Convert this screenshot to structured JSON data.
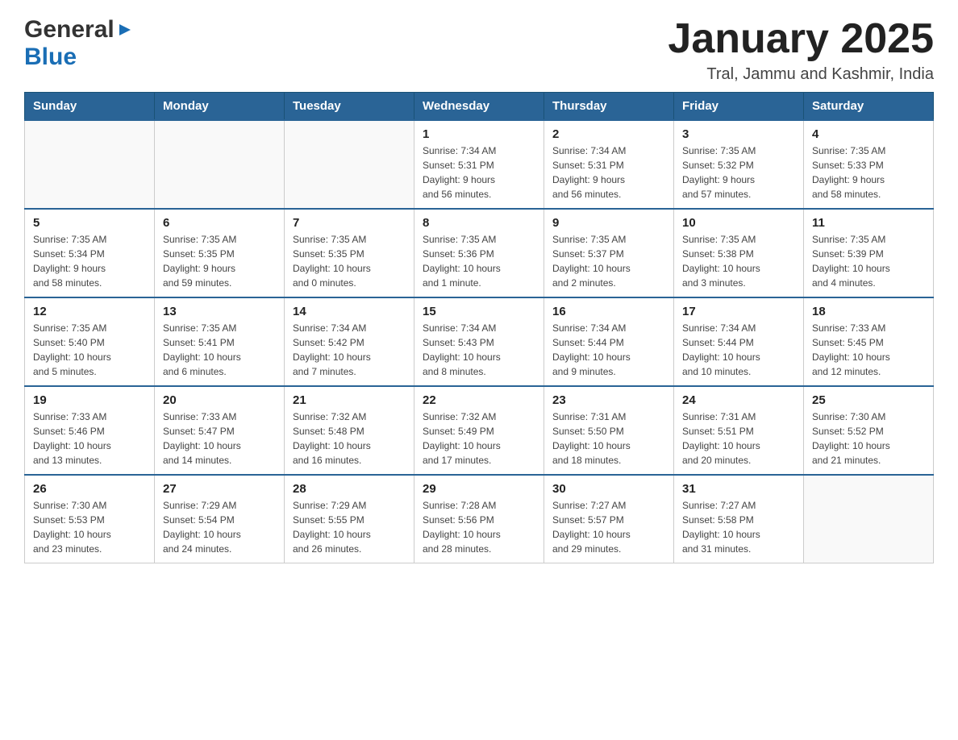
{
  "header": {
    "logo_general": "General",
    "logo_blue": "Blue",
    "month_year": "January 2025",
    "location": "Tral, Jammu and Kashmir, India"
  },
  "days_of_week": [
    "Sunday",
    "Monday",
    "Tuesday",
    "Wednesday",
    "Thursday",
    "Friday",
    "Saturday"
  ],
  "weeks": [
    [
      {
        "day": "",
        "info": ""
      },
      {
        "day": "",
        "info": ""
      },
      {
        "day": "",
        "info": ""
      },
      {
        "day": "1",
        "info": "Sunrise: 7:34 AM\nSunset: 5:31 PM\nDaylight: 9 hours\nand 56 minutes."
      },
      {
        "day": "2",
        "info": "Sunrise: 7:34 AM\nSunset: 5:31 PM\nDaylight: 9 hours\nand 56 minutes."
      },
      {
        "day": "3",
        "info": "Sunrise: 7:35 AM\nSunset: 5:32 PM\nDaylight: 9 hours\nand 57 minutes."
      },
      {
        "day": "4",
        "info": "Sunrise: 7:35 AM\nSunset: 5:33 PM\nDaylight: 9 hours\nand 58 minutes."
      }
    ],
    [
      {
        "day": "5",
        "info": "Sunrise: 7:35 AM\nSunset: 5:34 PM\nDaylight: 9 hours\nand 58 minutes."
      },
      {
        "day": "6",
        "info": "Sunrise: 7:35 AM\nSunset: 5:35 PM\nDaylight: 9 hours\nand 59 minutes."
      },
      {
        "day": "7",
        "info": "Sunrise: 7:35 AM\nSunset: 5:35 PM\nDaylight: 10 hours\nand 0 minutes."
      },
      {
        "day": "8",
        "info": "Sunrise: 7:35 AM\nSunset: 5:36 PM\nDaylight: 10 hours\nand 1 minute."
      },
      {
        "day": "9",
        "info": "Sunrise: 7:35 AM\nSunset: 5:37 PM\nDaylight: 10 hours\nand 2 minutes."
      },
      {
        "day": "10",
        "info": "Sunrise: 7:35 AM\nSunset: 5:38 PM\nDaylight: 10 hours\nand 3 minutes."
      },
      {
        "day": "11",
        "info": "Sunrise: 7:35 AM\nSunset: 5:39 PM\nDaylight: 10 hours\nand 4 minutes."
      }
    ],
    [
      {
        "day": "12",
        "info": "Sunrise: 7:35 AM\nSunset: 5:40 PM\nDaylight: 10 hours\nand 5 minutes."
      },
      {
        "day": "13",
        "info": "Sunrise: 7:35 AM\nSunset: 5:41 PM\nDaylight: 10 hours\nand 6 minutes."
      },
      {
        "day": "14",
        "info": "Sunrise: 7:34 AM\nSunset: 5:42 PM\nDaylight: 10 hours\nand 7 minutes."
      },
      {
        "day": "15",
        "info": "Sunrise: 7:34 AM\nSunset: 5:43 PM\nDaylight: 10 hours\nand 8 minutes."
      },
      {
        "day": "16",
        "info": "Sunrise: 7:34 AM\nSunset: 5:44 PM\nDaylight: 10 hours\nand 9 minutes."
      },
      {
        "day": "17",
        "info": "Sunrise: 7:34 AM\nSunset: 5:44 PM\nDaylight: 10 hours\nand 10 minutes."
      },
      {
        "day": "18",
        "info": "Sunrise: 7:33 AM\nSunset: 5:45 PM\nDaylight: 10 hours\nand 12 minutes."
      }
    ],
    [
      {
        "day": "19",
        "info": "Sunrise: 7:33 AM\nSunset: 5:46 PM\nDaylight: 10 hours\nand 13 minutes."
      },
      {
        "day": "20",
        "info": "Sunrise: 7:33 AM\nSunset: 5:47 PM\nDaylight: 10 hours\nand 14 minutes."
      },
      {
        "day": "21",
        "info": "Sunrise: 7:32 AM\nSunset: 5:48 PM\nDaylight: 10 hours\nand 16 minutes."
      },
      {
        "day": "22",
        "info": "Sunrise: 7:32 AM\nSunset: 5:49 PM\nDaylight: 10 hours\nand 17 minutes."
      },
      {
        "day": "23",
        "info": "Sunrise: 7:31 AM\nSunset: 5:50 PM\nDaylight: 10 hours\nand 18 minutes."
      },
      {
        "day": "24",
        "info": "Sunrise: 7:31 AM\nSunset: 5:51 PM\nDaylight: 10 hours\nand 20 minutes."
      },
      {
        "day": "25",
        "info": "Sunrise: 7:30 AM\nSunset: 5:52 PM\nDaylight: 10 hours\nand 21 minutes."
      }
    ],
    [
      {
        "day": "26",
        "info": "Sunrise: 7:30 AM\nSunset: 5:53 PM\nDaylight: 10 hours\nand 23 minutes."
      },
      {
        "day": "27",
        "info": "Sunrise: 7:29 AM\nSunset: 5:54 PM\nDaylight: 10 hours\nand 24 minutes."
      },
      {
        "day": "28",
        "info": "Sunrise: 7:29 AM\nSunset: 5:55 PM\nDaylight: 10 hours\nand 26 minutes."
      },
      {
        "day": "29",
        "info": "Sunrise: 7:28 AM\nSunset: 5:56 PM\nDaylight: 10 hours\nand 28 minutes."
      },
      {
        "day": "30",
        "info": "Sunrise: 7:27 AM\nSunset: 5:57 PM\nDaylight: 10 hours\nand 29 minutes."
      },
      {
        "day": "31",
        "info": "Sunrise: 7:27 AM\nSunset: 5:58 PM\nDaylight: 10 hours\nand 31 minutes."
      },
      {
        "day": "",
        "info": ""
      }
    ]
  ]
}
